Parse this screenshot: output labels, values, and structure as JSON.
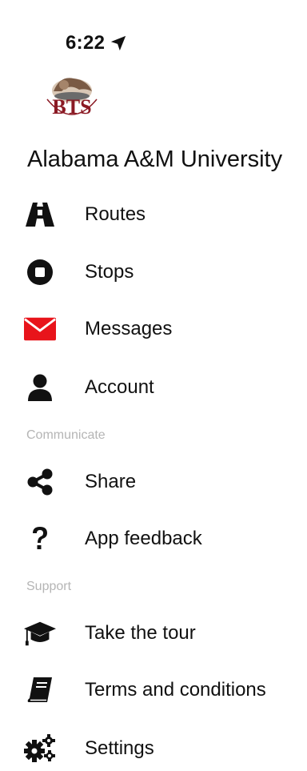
{
  "status_bar": {
    "time": "6:22"
  },
  "header": {
    "logo_text": "BTS",
    "organization": "Alabama A&M University"
  },
  "menu": {
    "primary": [
      {
        "label": "Routes",
        "icon": "road-icon"
      },
      {
        "label": "Stops",
        "icon": "stop-icon"
      },
      {
        "label": "Messages",
        "icon": "envelope-icon",
        "icon_color": "#e8141b"
      },
      {
        "label": "Account",
        "icon": "user-icon"
      }
    ],
    "communicate_header": "Communicate",
    "communicate": [
      {
        "label": "Share",
        "icon": "share-icon"
      },
      {
        "label": "App feedback",
        "icon": "question-icon"
      }
    ],
    "support_header": "Support",
    "support": [
      {
        "label": "Take the tour",
        "icon": "graduation-cap-icon"
      },
      {
        "label": "Terms and conditions",
        "icon": "book-icon"
      },
      {
        "label": "Settings",
        "icon": "gears-icon"
      }
    ]
  },
  "colors": {
    "text": "#111111",
    "section": "#b5b5b5",
    "messages_icon": "#e8141b",
    "logo_maroon": "#8b1a24"
  }
}
